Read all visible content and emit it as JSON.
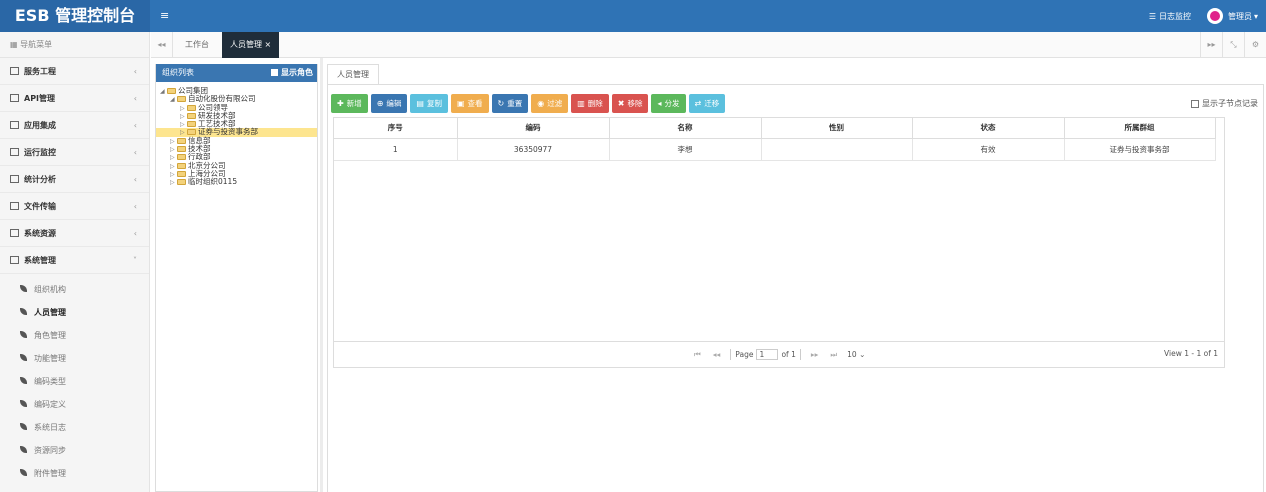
{
  "header": {
    "brand": "ESB 管理控制台",
    "menu_toggle": "≡",
    "log_monitor": "日志监控",
    "log_icon": "list-icon",
    "user": "管理员",
    "user_caret": "▾"
  },
  "sidebar": {
    "title": "导航菜单",
    "items": [
      {
        "label": "服务工程",
        "caret": "‹"
      },
      {
        "label": "API管理",
        "caret": "‹"
      },
      {
        "label": "应用集成",
        "caret": "‹"
      },
      {
        "label": "运行监控",
        "caret": "‹"
      },
      {
        "label": "统计分析",
        "caret": "‹"
      },
      {
        "label": "文件传输",
        "caret": "‹"
      },
      {
        "label": "系统资源",
        "caret": "‹"
      },
      {
        "label": "系统管理",
        "caret": "˅"
      }
    ],
    "sub_items": [
      "组织机构",
      "人员管理",
      "角色管理",
      "功能管理",
      "编码类型",
      "编码定义",
      "系统日志",
      "资源同步",
      "附件管理"
    ],
    "active_sub": "人员管理"
  },
  "tabs": {
    "left_arrow": "◂◂",
    "items": [
      {
        "label": "工作台"
      },
      {
        "label": "人员管理",
        "close": "×"
      }
    ],
    "right_arrows": "▸▸",
    "fullscreen": "⤡",
    "settings": "⚙"
  },
  "org_panel": {
    "title": "组织列表",
    "toggle_label": "显示角色",
    "tree": [
      {
        "label": "公司集团",
        "level": 0,
        "expanded": true
      },
      {
        "label": "自动化股份有限公司",
        "level": 1,
        "expanded": true
      },
      {
        "label": "公司领导",
        "level": 2
      },
      {
        "label": "研发技术部",
        "level": 2
      },
      {
        "label": "工艺技术部",
        "level": 2
      },
      {
        "label": "证券与投资事务部",
        "level": 2,
        "selected": true
      },
      {
        "label": "信息部",
        "level": 1
      },
      {
        "label": "技术部",
        "level": 1
      },
      {
        "label": "行政部",
        "level": 1
      },
      {
        "label": "北京分公司",
        "level": 1
      },
      {
        "label": "上海分公司",
        "level": 1
      },
      {
        "label": "临时组织0115",
        "level": 1
      }
    ]
  },
  "content": {
    "tab_label": "人员管理",
    "show_child_records": "显示子节点记录",
    "toolbar": [
      {
        "label": "新增",
        "icon": "✚",
        "color": "#5cb85c"
      },
      {
        "label": "编辑",
        "icon": "⊕",
        "color": "#3a76b1"
      },
      {
        "label": "复制",
        "icon": "▤",
        "color": "#5bc0de"
      },
      {
        "label": "查看",
        "icon": "▣",
        "color": "#f0ad4e"
      },
      {
        "label": "重置",
        "icon": "↻",
        "color": "#3a76b1"
      },
      {
        "label": "过滤",
        "icon": "◉",
        "color": "#f0ad4e"
      },
      {
        "label": "删除",
        "icon": "▥",
        "color": "#d9534f"
      },
      {
        "label": "移除",
        "icon": "✖",
        "color": "#d9534f"
      },
      {
        "label": "分发",
        "icon": "◂",
        "color": "#5cb85c"
      },
      {
        "label": "迁移",
        "icon": "⇄",
        "color": "#5bc0de"
      }
    ],
    "table": {
      "columns": [
        "序号",
        "编码",
        "名称",
        "性别",
        "状态",
        "所属群组"
      ],
      "rows": [
        [
          "1",
          "36350977",
          "李想",
          "",
          "有效",
          "证券与投资事务部"
        ]
      ]
    },
    "pager": {
      "page_label": "Page",
      "page_value": "1",
      "of_label": "of 1",
      "page_size": "10",
      "view_text": "View 1 - 1 of 1"
    }
  }
}
